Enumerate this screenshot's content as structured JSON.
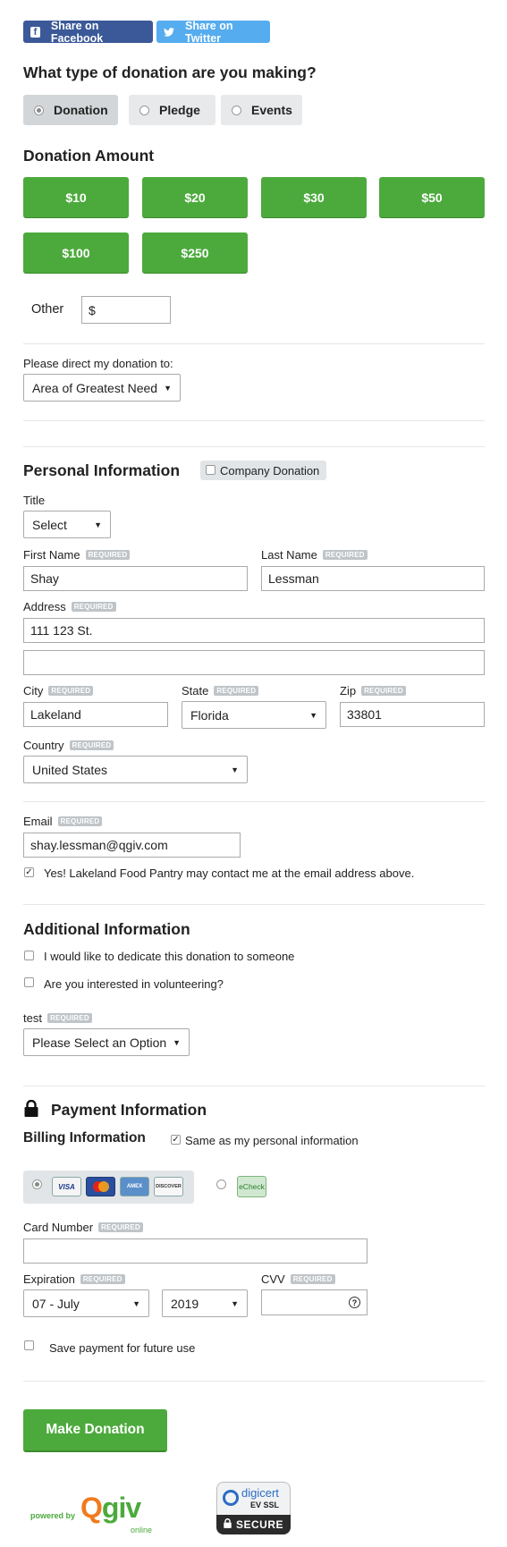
{
  "social": {
    "facebook": "Share on Facebook",
    "twitter": "Share on Twitter"
  },
  "donation_type": {
    "heading": "What type of donation are you making?",
    "options": [
      "Donation",
      "Pledge",
      "Events"
    ],
    "selected": "Donation"
  },
  "amount": {
    "heading": "Donation Amount",
    "buttons": [
      "$10",
      "$20",
      "$30",
      "$50",
      "$100",
      "$250"
    ],
    "other_label": "Other",
    "other_placeholder": "$"
  },
  "direct": {
    "label": "Please direct my donation to:",
    "value": "Area of Greatest Need"
  },
  "personal": {
    "heading": "Personal Information",
    "company_label": "Company Donation",
    "required": "REQUIRED",
    "title_label": "Title",
    "title_value": "Select",
    "first_name_label": "First Name",
    "first_name": "Shay",
    "last_name_label": "Last Name",
    "last_name": "Lessman",
    "address_label": "Address",
    "address1": "111 123 St.",
    "address2": "",
    "city_label": "City",
    "city": "Lakeland",
    "state_label": "State",
    "state": "Florida",
    "zip_label": "Zip",
    "zip": "33801",
    "country_label": "Country",
    "country": "United States",
    "email_label": "Email",
    "email": "shay.lessman@qgiv.com",
    "contact_text": "Yes! Lakeland Food Pantry may contact me at the email address above."
  },
  "additional": {
    "heading": "Additional Information",
    "dedicate_text": "I would like to dedicate this donation to someone",
    "volunteer_text": "Are you interested in volunteering?",
    "test_label": "test",
    "test_value": "Please Select an Option"
  },
  "payment": {
    "heading": "Payment Information",
    "billing_heading": "Billing Information",
    "same_text": "Same as my personal information",
    "cards": [
      "VISA",
      "MC",
      "AMEX",
      "DISCOVER"
    ],
    "echeck": "eCheck",
    "card_number_label": "Card Number",
    "expiration_label": "Expiration",
    "exp_month": "07 - July",
    "exp_year": "2019",
    "cvv_label": "CVV",
    "save_text": "Save payment for future use",
    "submit": "Make Donation"
  },
  "footer": {
    "powered_by": "powered by",
    "qgiv": "Qgiv",
    "online": "online",
    "digicert": "digicert",
    "ev_ssl": "EV SSL",
    "secure": "SECURE"
  },
  "colors": {
    "green": "#4caa3c",
    "facebook": "#3b5998",
    "twitter": "#55acee"
  }
}
